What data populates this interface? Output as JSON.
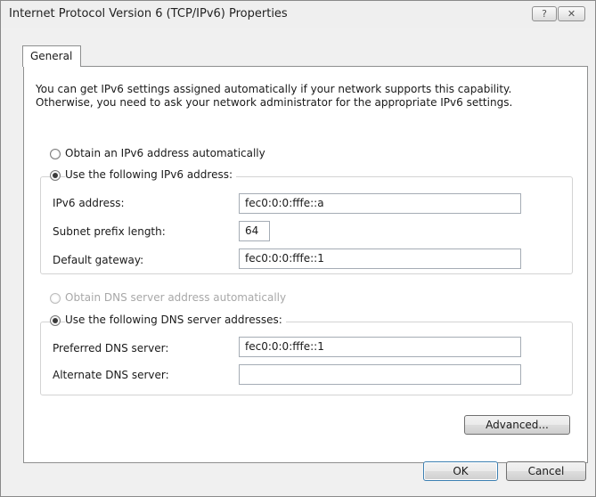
{
  "window": {
    "title": "Internet Protocol Version 6 (TCP/IPv6) Properties",
    "help_button": "?",
    "close_button": "✕"
  },
  "tabs": [
    {
      "label": "General"
    }
  ],
  "description": {
    "line1": "You can get IPv6 settings assigned automatically if your network supports this capability.",
    "line2": "Otherwise, you need to ask your network administrator for the appropriate IPv6 settings."
  },
  "ip_section": {
    "auto_label": "Obtain an IPv6 address automatically",
    "auto_selected": false,
    "manual_label": "Use the following IPv6 address:",
    "manual_selected": true,
    "fields": {
      "address": {
        "label": "IPv6 address:",
        "value": "fec0:0:0:fffe::a"
      },
      "prefix": {
        "label": "Subnet prefix length:",
        "value": "64"
      },
      "gateway": {
        "label": "Default gateway:",
        "value": "fec0:0:0:fffe::1"
      }
    }
  },
  "dns_section": {
    "auto_label": "Obtain DNS server address automatically",
    "auto_selected": false,
    "auto_disabled": true,
    "manual_label": "Use the following DNS server addresses:",
    "manual_selected": true,
    "fields": {
      "preferred": {
        "label": "Preferred DNS server:",
        "value": "fec0:0:0:fffe::1"
      },
      "alternate": {
        "label": "Alternate DNS server:",
        "value": ""
      }
    }
  },
  "buttons": {
    "advanced": "Advanced...",
    "ok": "OK",
    "cancel": "Cancel"
  }
}
